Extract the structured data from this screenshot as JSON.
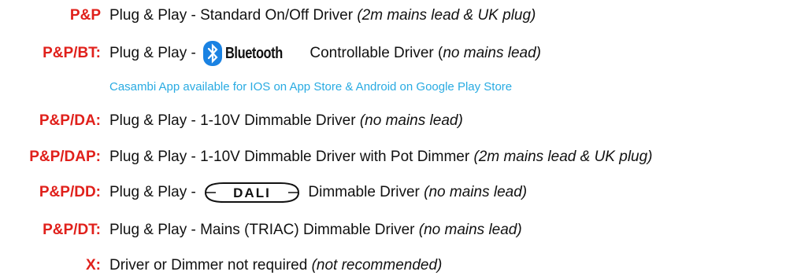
{
  "colors": {
    "code": "#e0201b",
    "note": "#29abe2",
    "text": "#111111"
  },
  "rows": [
    {
      "code": "P&P",
      "text": "Plug & Play - Standard On/Off Driver ",
      "italic": "(2m mains lead & UK plug)"
    },
    {
      "code": "P&P/BT:",
      "pre": "Plug & Play - ",
      "logo_word": "Bluetooth",
      "text": " Controllable Driver (",
      "italic": "no mains lead)",
      "note": "Casambi App available for IOS on App Store & Android on Google Play Store"
    },
    {
      "code": "P&P/DA:",
      "text": "Plug & Play - 1-10V Dimmable Driver ",
      "italic": "(no mains lead)"
    },
    {
      "code": "P&P/DAP:",
      "text": "Plug & Play - 1-10V Dimmable Driver with Pot Dimmer ",
      "italic": "(2m mains lead & UK plug)"
    },
    {
      "code": "P&P/DD:",
      "pre": "Plug & Play - ",
      "logo_word": "DALI",
      "text": " Dimmable Driver ",
      "italic": "(no mains lead)"
    },
    {
      "code": "P&P/DT:",
      "text": "Plug & Play - Mains (TRIAC) Dimmable Driver ",
      "italic": "(no mains lead)"
    },
    {
      "code": "X:",
      "text": "Driver or Dimmer not required ",
      "italic": "(not recommended)"
    }
  ]
}
